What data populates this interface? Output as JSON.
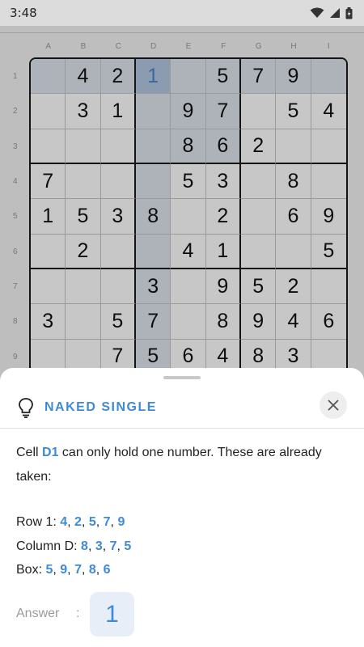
{
  "status_bar": {
    "time": "3:48",
    "icons": [
      "wifi-icon",
      "signal-icon",
      "battery-icon"
    ]
  },
  "board": {
    "col_labels": [
      "A",
      "B",
      "C",
      "D",
      "E",
      "F",
      "G",
      "H",
      "I"
    ],
    "row_labels": [
      "1",
      "2",
      "3",
      "4",
      "5",
      "6",
      "7",
      "8",
      "9"
    ],
    "cells": [
      [
        "",
        "4",
        "2",
        "1",
        "",
        "5",
        "7",
        "9",
        ""
      ],
      [
        "",
        "3",
        "1",
        "",
        "9",
        "7",
        "",
        "5",
        "4"
      ],
      [
        "",
        "",
        "",
        "",
        "8",
        "6",
        "2",
        "",
        ""
      ],
      [
        "7",
        "",
        "",
        "",
        "5",
        "3",
        "",
        "8",
        ""
      ],
      [
        "1",
        "5",
        "3",
        "8",
        "",
        "2",
        "",
        "6",
        "9"
      ],
      [
        "",
        "2",
        "",
        "",
        "4",
        "1",
        "",
        "",
        "5"
      ],
      [
        "",
        "",
        "",
        "3",
        "",
        "9",
        "5",
        "2",
        ""
      ],
      [
        "3",
        "",
        "5",
        "7",
        "",
        "8",
        "9",
        "4",
        "6"
      ],
      [
        "",
        "",
        "7",
        "5",
        "6",
        "4",
        "8",
        "3",
        ""
      ]
    ],
    "target_cell": "D1",
    "colors": {
      "highlight": "#dfe6ef",
      "strong_highlight": "#c7d5e8",
      "target": "#b3c7e2",
      "accent": "#3f8ad8"
    }
  },
  "hint": {
    "title": "NAKED SINGLE",
    "icon": "lightbulb-icon",
    "close_icon": "close-icon",
    "explain_prefix": "Cell ",
    "cell": "D1",
    "explain_suffix": " can only hold one number. These are already taken:",
    "row": {
      "label": "Row 1: ",
      "values": [
        "4",
        "2",
        "5",
        "7",
        "9"
      ]
    },
    "column": {
      "label": "Column D: ",
      "values": [
        "8",
        "3",
        "7",
        "5"
      ]
    },
    "box": {
      "label": "Box: ",
      "values": [
        "5",
        "9",
        "7",
        "8",
        "6"
      ]
    },
    "answer_label": "Answer",
    "answer_colon": ":",
    "answer_value": "1"
  }
}
